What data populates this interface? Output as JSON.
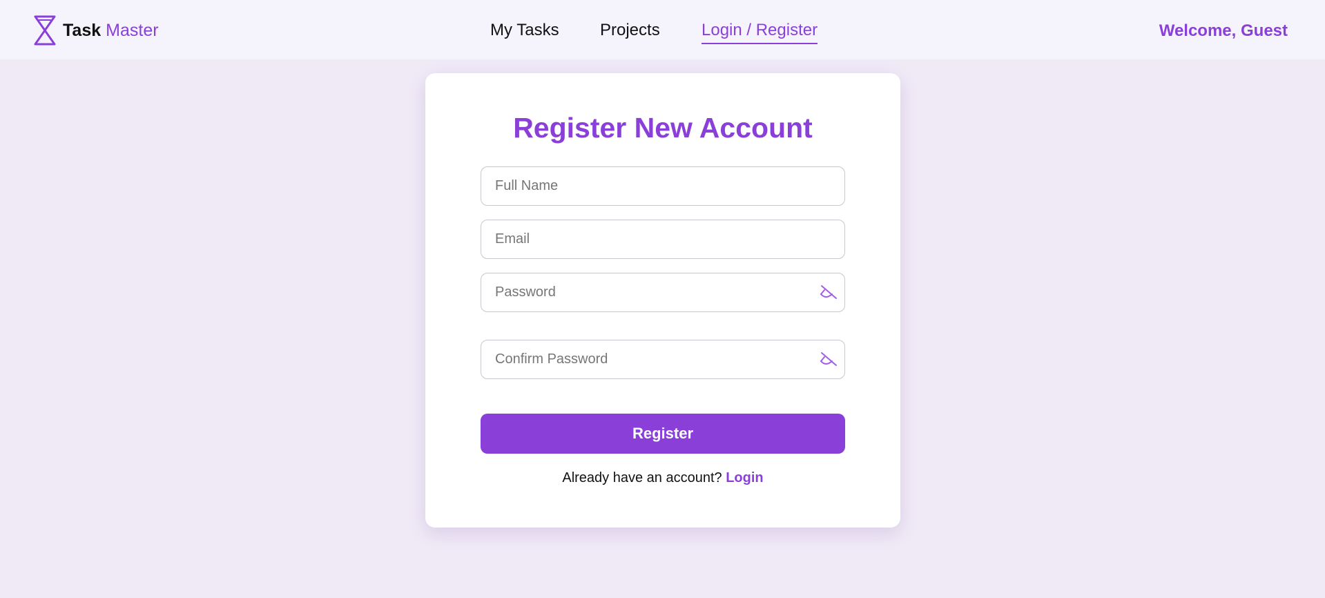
{
  "header": {
    "brand_bold": "Task",
    "brand_light": "Master",
    "brand_icon": "hourglass-icon",
    "nav": {
      "tasks_label": "My Tasks",
      "projects_label": "Projects",
      "login_label": "Login / Register",
      "active": "Login / Register"
    },
    "welcome": "Welcome, Guest"
  },
  "form": {
    "title": "Register New Account",
    "fields": {
      "full_name": {
        "placeholder": "Full Name",
        "value": ""
      },
      "email": {
        "placeholder": "Email",
        "value": ""
      },
      "password": {
        "placeholder": "Password",
        "value": "",
        "toggle_icon": "eye-off-icon"
      },
      "confirm_password": {
        "placeholder": "Confirm Password",
        "value": "",
        "toggle_icon": "eye-off-icon"
      }
    },
    "submit_label": "Register",
    "switch_prompt": "Already have an account?",
    "switch_link": "Login"
  },
  "colors": {
    "accent": "#8a3fd9",
    "page_background": "#f0eaf7",
    "header_background": "#f5f3fc",
    "card_background": "#ffffff"
  }
}
